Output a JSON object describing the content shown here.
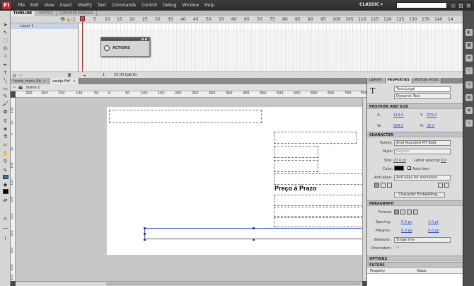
{
  "app": {
    "logo": "Fl"
  },
  "menu": [
    "File",
    "Edit",
    "View",
    "Insert",
    "Modify",
    "Text",
    "Commands",
    "Control",
    "Debug",
    "Window",
    "Help"
  ],
  "workspace": "CLASSIC ▾",
  "window_buttons": [
    "–",
    "□",
    "×"
  ],
  "timeline": {
    "tabs": [
      "TIMELINE",
      "OUTPUT",
      "COMPILER ERRORS"
    ],
    "layer_name": "Layer 1",
    "ruler": [
      "1",
      "5",
      "10",
      "15",
      "20",
      "25",
      "30",
      "35",
      "40",
      "45",
      "50",
      "55",
      "60",
      "65",
      "70",
      "75",
      "80",
      "85",
      "90",
      "95",
      "100",
      "105",
      "110",
      "115",
      "120",
      "125",
      "130",
      "135",
      "140",
      "14"
    ],
    "status": {
      "frame": "1",
      "fps": "25.00 fps",
      "time": "0.0s"
    }
  },
  "actions_panel": {
    "label": "ACTIONS"
  },
  "document": {
    "tabs": [
      {
        "label": "home_menu.fla"
      },
      {
        "label": "varejo.fla*"
      }
    ],
    "close": "×",
    "scene": "Scene 1",
    "hruler": [
      "250",
      "200",
      "150",
      "100",
      "50",
      "0",
      "50",
      "100",
      "150",
      "200",
      "250",
      "300",
      "350",
      "400",
      "450",
      "500",
      "550",
      "600",
      "650",
      "700",
      "750"
    ],
    "vruler": [
      "100",
      "50",
      "0",
      "50",
      "100",
      "150",
      "200",
      "250",
      "300",
      "350",
      "400",
      "450"
    ],
    "stage_text": "Preço à Prazo"
  },
  "properties": {
    "tabs": [
      "LIBRARY",
      "PROPERTIES",
      "MOTION PRESE"
    ],
    "instance_name": "TextoLegal",
    "text_type": "Dynamic Text",
    "position_size": {
      "title": "POSITION AND SIZE",
      "x_label": "X:",
      "x": "114.0",
      "y_label": "Y:",
      "y": "370.0",
      "w_label": "W:",
      "w": "664.0",
      "h_label": "H:",
      "h": "35.0"
    },
    "character": {
      "title": "CHARACTER",
      "family_label": "Family:",
      "family": "Arial Rounded MT Bold",
      "style_label": "Style:",
      "style": "Regular",
      "size_label": "Size:",
      "size": "20.0 pt",
      "letter_spacing_label": "Letter spacing:",
      "letter_spacing": "0.0",
      "color_label": "Color:",
      "color": "#000000",
      "autokern_label": "Auto kern",
      "antialias_label": "Anti-alias:",
      "antialias": "Anti-alias for animation",
      "embed_button": "Character Embedding..."
    },
    "paragraph": {
      "title": "PARAGRAPH",
      "format_label": "Format:",
      "spacing_label": "Spacing:",
      "spacing1": "0.0 px",
      "spacing2": "2.0 pt",
      "margins_label": "Margins:",
      "margin1": "0.0 px",
      "margin2": "0.0 px",
      "behavior_label": "Behavior:",
      "behavior": "Single line",
      "orientation_label": "Orientation:"
    },
    "options": {
      "title": "OPTIONS"
    },
    "filters": {
      "title": "FILTERS",
      "columns": [
        "Property",
        "Value"
      ]
    }
  },
  "colors": {
    "accent": "#c0282f",
    "selection": "#2142c5",
    "link": "#2b52c8"
  }
}
